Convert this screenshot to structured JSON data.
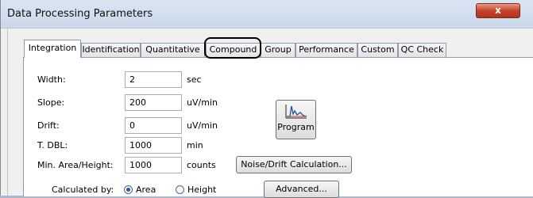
{
  "window": {
    "title": "Data Processing Parameters",
    "close_label": "x"
  },
  "tabs": [
    {
      "label": "Integration"
    },
    {
      "label": "Identification"
    },
    {
      "label": "Quantitative"
    },
    {
      "label": "Compound"
    },
    {
      "label": "Group"
    },
    {
      "label": "Performance"
    },
    {
      "label": "Custom"
    },
    {
      "label": "QC Check"
    }
  ],
  "fields": {
    "width": {
      "label": "Width:",
      "value": "2",
      "unit": "sec"
    },
    "slope": {
      "label": "Slope:",
      "value": "200",
      "unit": "uV/min"
    },
    "drift": {
      "label": "Drift:",
      "value": "0",
      "unit": "uV/min"
    },
    "tdbl": {
      "label": "T. DBL:",
      "value": "1000",
      "unit": "min"
    },
    "min_area": {
      "label": "Min. Area/Height:",
      "value": "1000",
      "unit": "counts"
    }
  },
  "buttons": {
    "program": "Program",
    "noise_drift": "Noise/Drift Calculation...",
    "advanced": "Advanced..."
  },
  "calculated_by": {
    "label": "Calculated by:",
    "options": [
      {
        "label": "Area",
        "selected": true
      },
      {
        "label": "Height",
        "selected": false
      }
    ]
  },
  "icons": {
    "program": "chromatogram-peak-icon"
  }
}
